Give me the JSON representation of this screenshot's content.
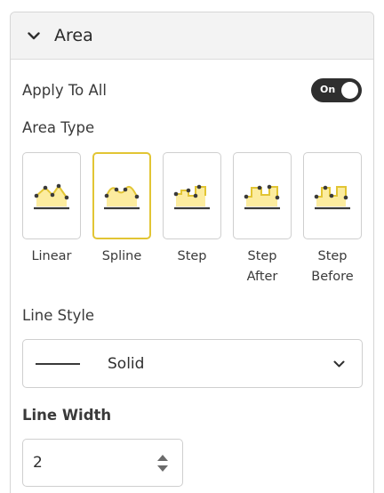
{
  "panel": {
    "title": "Area",
    "expanded_icon": "chevron-down-icon"
  },
  "apply_to_all": {
    "label": "Apply To All",
    "toggle_text": "On",
    "state": true
  },
  "area_type": {
    "label": "Area Type",
    "selected": "Spline",
    "options": [
      {
        "label": "Linear",
        "icon": "linear-area-icon"
      },
      {
        "label": "Spline",
        "icon": "spline-area-icon"
      },
      {
        "label": "Step",
        "icon": "step-area-icon"
      },
      {
        "label": "Step After",
        "icon": "step-after-area-icon"
      },
      {
        "label": "Step Before",
        "icon": "step-before-area-icon"
      }
    ]
  },
  "line_style": {
    "label": "Line Style",
    "value": "Solid"
  },
  "line_width": {
    "label": "Line Width",
    "value": "2"
  },
  "colors": {
    "accent": "#e2c534",
    "area_fill": "#fcec9f",
    "toggle_bg": "#2f2f2f"
  }
}
